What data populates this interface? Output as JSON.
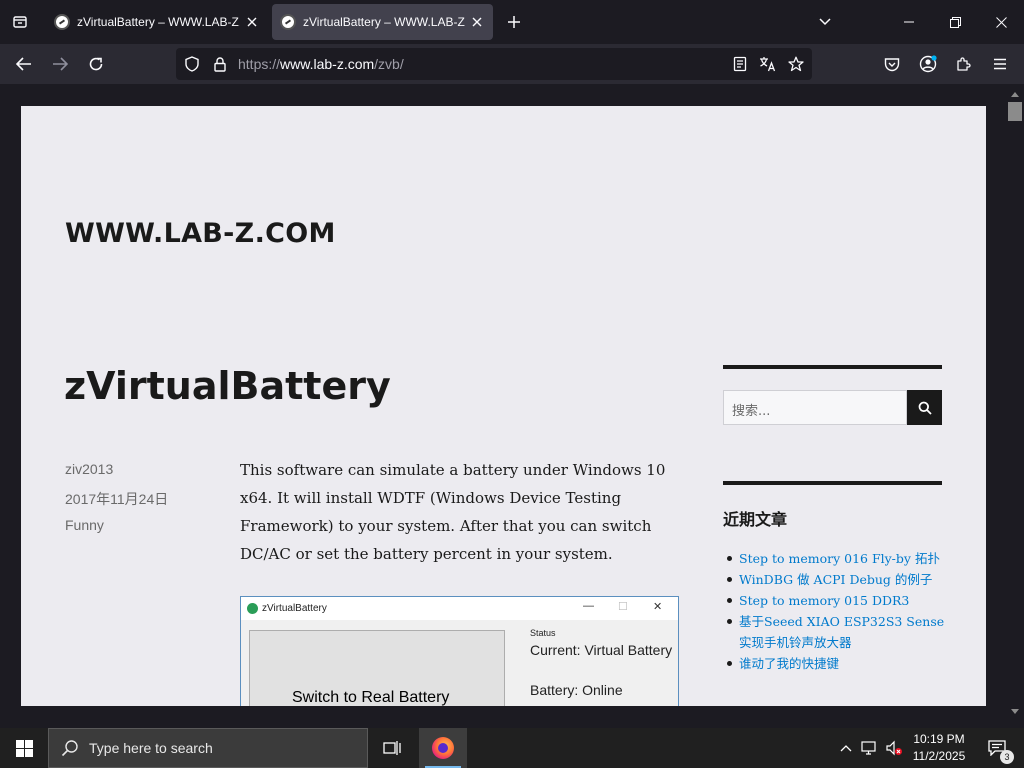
{
  "browser": {
    "tabs": [
      {
        "title": "zVirtualBattery – WWW.LAB-Z.COM",
        "active": false
      },
      {
        "title": "zVirtualBattery – WWW.LAB-Z.COM",
        "active": true
      }
    ],
    "url": {
      "prefix": "https://",
      "host": "www.lab-z.com",
      "path": "/zvb/"
    },
    "icons": [
      "tab-list-icon",
      "close-icon",
      "plus-icon",
      "chevron-down-icon",
      "minimize-icon",
      "restore-icon",
      "close-window-icon",
      "back-icon",
      "forward-icon",
      "reload-icon",
      "shield-icon",
      "lock-icon",
      "reader-view-icon",
      "translate-icon",
      "star-icon",
      "pocket-icon",
      "account-icon",
      "extensions-icon",
      "menu-icon"
    ]
  },
  "page": {
    "site_title": "WWW.LAB-Z.COM",
    "entry_title": "zVirtualBattery",
    "meta": {
      "author": "ziv2013",
      "date": "2017年11月24日",
      "category": "Funny"
    },
    "body": "This software can simulate a battery under Windows 10 x64. It will install WDTF (Windows Device Testing Framework) to your system. After that you can switch DC/AC or set the battery percent in your system.",
    "app_screenshot": {
      "window_title": "zVirtualBattery",
      "button_label": "Switch to Real Battery",
      "status_label": "Status",
      "current_text": "Current: Virtual Battery",
      "battery_text": "Battery: Online"
    }
  },
  "sidebar": {
    "search_placeholder": "搜索...",
    "recent_title": "近期文章",
    "recent_posts": [
      "Step to memory 016 Fly-by 拓扑",
      "WinDBG 做 ACPI Debug 的例子",
      "Step to memory 015 DDR3",
      "基于Seeed XIAO ESP32S3 Sense实现手机铃声放大器",
      "谁动了我的快捷键"
    ]
  },
  "taskbar": {
    "search_placeholder": "Type here to search",
    "time": "10:19 PM",
    "date": "11/2/2025",
    "notification_count": "3"
  },
  "colors": {
    "accent": "#007acc",
    "chrome_dark": "#1c1b22",
    "page_bg": "#ecebf0"
  }
}
